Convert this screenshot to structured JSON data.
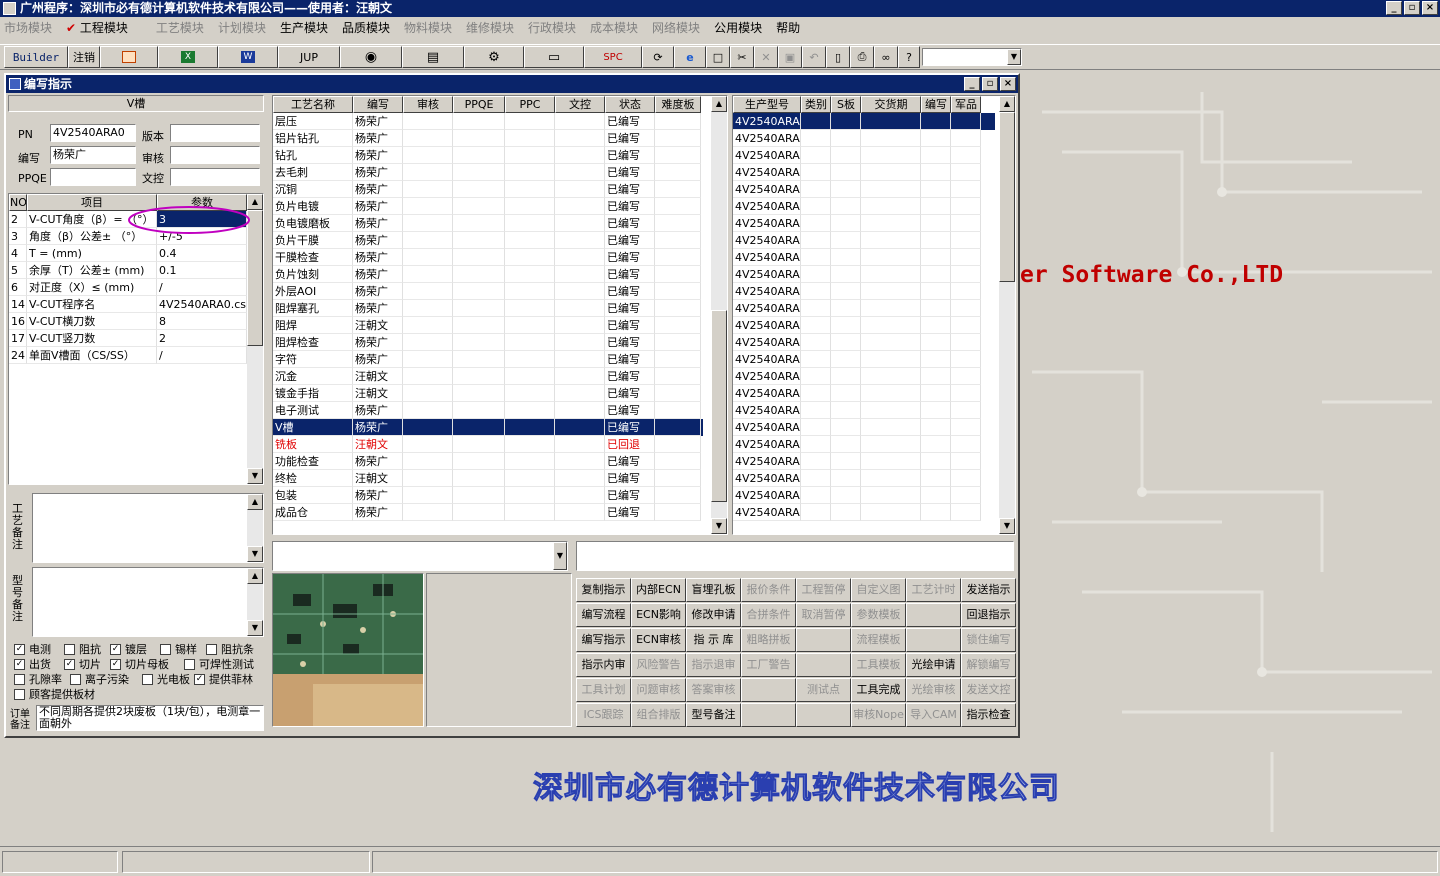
{
  "app": {
    "title": "广州程序：深圳市必有德计算机软件技术有限公司——使用者：汪朝文",
    "window_buttons": [
      "_",
      "▫",
      "×"
    ]
  },
  "menu": [
    "市场模块",
    "工程模块",
    "工艺模块",
    "计划模块",
    "生产模块",
    "品质模块",
    "物料模块",
    "维修模块",
    "行政模块",
    "成本模块",
    "网络模块",
    "公用模块",
    "帮助"
  ],
  "toolbar": {
    "builder": "Builder",
    "logout": "注销",
    "jup": "JUP",
    "spc": "SPC",
    "combo_value": ""
  },
  "mdi": {
    "title": "编写指示"
  },
  "left": {
    "section_title": "V槽",
    "pn_label": "PN",
    "pn_value": "4V2540ARA0",
    "version_label": "版本",
    "version_value": "",
    "author_label": "编写",
    "author_value": "杨荣广",
    "review_label": "审核",
    "review_value": "",
    "ppqe_label": "PPQE",
    "ppqe_value": "",
    "doc_label": "文控",
    "doc_value": "",
    "param_headers": [
      "NO",
      "项目",
      "参数"
    ],
    "params": [
      {
        "no": "2",
        "item": "V-CUT角度（β）=  （°）",
        "value": "3"
      },
      {
        "no": "3",
        "item": "角度（β）公差±  （°）",
        "value": "+/-5"
      },
      {
        "no": "4",
        "item": "T =   (mm)",
        "value": "0.4"
      },
      {
        "no": "5",
        "item": "余厚（T）公差±   (mm)",
        "value": "0.1"
      },
      {
        "no": "6",
        "item": "对正度（X）≤  (mm)",
        "value": "/"
      },
      {
        "no": "14",
        "item": "V-CUT程序名",
        "value": "4V2540ARA0.csv"
      },
      {
        "no": "16",
        "item": "V-CUT横刀数",
        "value": "8"
      },
      {
        "no": "17",
        "item": "V-CUT竖刀数",
        "value": "2"
      },
      {
        "no": "24",
        "item": "单面V槽面（CS/SS）",
        "value": "/"
      }
    ],
    "process_note_label": "工艺备注",
    "model_note_label": "型号备注",
    "checkboxes": [
      {
        "label": "电测",
        "checked": true
      },
      {
        "label": "阻抗",
        "checked": false
      },
      {
        "label": "镀层",
        "checked": true
      },
      {
        "label": "锡样",
        "checked": false
      },
      {
        "label": "阻抗条",
        "checked": false
      },
      {
        "label": "出货",
        "checked": true
      },
      {
        "label": "切片",
        "checked": true
      },
      {
        "label": "切片母板",
        "checked": true
      },
      {
        "label": "可焊性测试",
        "checked": false
      },
      {
        "label": "孔隙率",
        "checked": false
      },
      {
        "label": "离子污染",
        "checked": false
      },
      {
        "label": "光电板",
        "checked": false
      },
      {
        "label": "提供菲林",
        "checked": true
      },
      {
        "label": "顾客提供板材",
        "checked": false
      }
    ],
    "order_note_label": "订单备注",
    "order_note_value": "不同周期各提供2块废板（1块/包），电测章一面朝外"
  },
  "process_grid": {
    "headers": [
      "工艺名称",
      "编写",
      "审核",
      "PPQE",
      "PPC",
      "文控",
      "状态",
      "难度板"
    ],
    "rows": [
      {
        "name": "层压",
        "author": "杨荣广",
        "status": "已编写"
      },
      {
        "name": "铝片钻孔",
        "author": "杨荣广",
        "status": "已编写"
      },
      {
        "name": "钻孔",
        "author": "杨荣广",
        "status": "已编写"
      },
      {
        "name": "去毛刺",
        "author": "杨荣广",
        "status": "已编写"
      },
      {
        "name": "沉铜",
        "author": "杨荣广",
        "status": "已编写"
      },
      {
        "name": "负片电镀",
        "author": "杨荣广",
        "status": "已编写"
      },
      {
        "name": "负电镀磨板",
        "author": "杨荣广",
        "status": "已编写"
      },
      {
        "name": "负片干膜",
        "author": "杨荣广",
        "status": "已编写"
      },
      {
        "name": "干膜检查",
        "author": "杨荣广",
        "status": "已编写"
      },
      {
        "name": "负片蚀刻",
        "author": "杨荣广",
        "status": "已编写"
      },
      {
        "name": "外层AOI",
        "author": "杨荣广",
        "status": "已编写"
      },
      {
        "name": "阻焊塞孔",
        "author": "杨荣广",
        "status": "已编写"
      },
      {
        "name": "阻焊",
        "author": "汪朝文",
        "status": "已编写"
      },
      {
        "name": "阻焊检查",
        "author": "杨荣广",
        "status": "已编写"
      },
      {
        "name": "字符",
        "author": "杨荣广",
        "status": "已编写"
      },
      {
        "name": "沉金",
        "author": "汪朝文",
        "status": "已编写"
      },
      {
        "name": "镀金手指",
        "author": "汪朝文",
        "status": "已编写"
      },
      {
        "name": "电子测试",
        "author": "杨荣广",
        "status": "已编写"
      },
      {
        "name": "V槽",
        "author": "杨荣广",
        "status": "已编写"
      },
      {
        "name": "铣板",
        "author": "汪朝文",
        "status": "已回退"
      },
      {
        "name": "功能检查",
        "author": "杨荣广",
        "status": "已编写"
      },
      {
        "name": "终检",
        "author": "汪朝文",
        "status": "已编写"
      },
      {
        "name": "包装",
        "author": "杨荣广",
        "status": "已编写"
      },
      {
        "name": "成品仓",
        "author": "杨荣广",
        "status": "已编写"
      }
    ],
    "selected_index": 18,
    "alert_index": 19
  },
  "model_grid": {
    "headers": [
      "生产型号",
      "类别",
      "S板",
      "交货期",
      "编写",
      "军品"
    ],
    "rows": [
      "4V2540ARA0",
      "4V2540ARA0",
      "4V2540ARA0",
      "4V2540ARA0",
      "4V2540ARA0",
      "4V2540ARA0",
      "4V2540ARA0",
      "4V2540ARA0",
      "4V2540ARA0",
      "4V2540ARA0",
      "4V2540ARA0",
      "4V2540ARA0",
      "4V2540ARA0",
      "4V2540ARA0",
      "4V2540ARA0",
      "4V2540ARA0",
      "4V2540ARA0",
      "4V2540ARA0",
      "4V2540ARA0",
      "4V2540ARA0",
      "4V2540ARA0",
      "4V2540ARA0",
      "4V2540ARA0",
      "4V2540ARA0"
    ],
    "selected_index": 0
  },
  "actions": [
    [
      {
        "t": "复制指示",
        "e": true
      },
      {
        "t": "内部ECN",
        "e": true
      },
      {
        "t": "盲埋孔板",
        "e": true
      },
      {
        "t": "报价条件",
        "e": false
      },
      {
        "t": "工程暂停",
        "e": false
      },
      {
        "t": "自定义图",
        "e": false
      },
      {
        "t": "工艺计时",
        "e": false
      },
      {
        "t": "发送指示",
        "e": true
      }
    ],
    [
      {
        "t": "编写流程",
        "e": true
      },
      {
        "t": "ECN影响",
        "e": true
      },
      {
        "t": "修改申请",
        "e": true
      },
      {
        "t": "合拼条件",
        "e": false
      },
      {
        "t": "取消暂停",
        "e": false
      },
      {
        "t": "参数模板",
        "e": false
      },
      {
        "t": "",
        "e": false
      },
      {
        "t": "回退指示",
        "e": true
      }
    ],
    [
      {
        "t": "编写指示",
        "e": true
      },
      {
        "t": "ECN审核",
        "e": true
      },
      {
        "t": "指 示 库",
        "e": true
      },
      {
        "t": "粗略拼板",
        "e": false
      },
      {
        "t": "",
        "e": false
      },
      {
        "t": "流程模板",
        "e": false
      },
      {
        "t": "",
        "e": false
      },
      {
        "t": "锁住编写",
        "e": false
      }
    ],
    [
      {
        "t": "指示内审",
        "e": true
      },
      {
        "t": "风险警告",
        "e": false
      },
      {
        "t": "指示退审",
        "e": false
      },
      {
        "t": "工厂警告",
        "e": false
      },
      {
        "t": "",
        "e": false
      },
      {
        "t": "工具模板",
        "e": false
      },
      {
        "t": "光绘申请",
        "e": true
      },
      {
        "t": "解锁编写",
        "e": false
      }
    ],
    [
      {
        "t": "工具计划",
        "e": false
      },
      {
        "t": "问题审核",
        "e": false
      },
      {
        "t": "答案审核",
        "e": false
      },
      {
        "t": "",
        "e": false
      },
      {
        "t": "测试点",
        "e": false
      },
      {
        "t": "工具完成",
        "e": true
      },
      {
        "t": "光绘审核",
        "e": false
      },
      {
        "t": "发送文控",
        "e": false
      }
    ],
    [
      {
        "t": "ICS跟踪",
        "e": false
      },
      {
        "t": "组合排版",
        "e": false
      },
      {
        "t": "型号备注",
        "e": true
      },
      {
        "t": "",
        "e": false
      },
      {
        "t": "",
        "e": false
      },
      {
        "t": "审核Nope",
        "e": false
      },
      {
        "t": "导入CAM",
        "e": false
      },
      {
        "t": "指示检查",
        "e": true
      }
    ]
  ],
  "background": {
    "company_en": "er Software Co.,LTD",
    "company_cn": "深圳市必有德计算机软件技术有限公司"
  },
  "colors": {
    "titlebar": "#0a246a",
    "face": "#d4d0c8",
    "alert": "#e00000"
  }
}
